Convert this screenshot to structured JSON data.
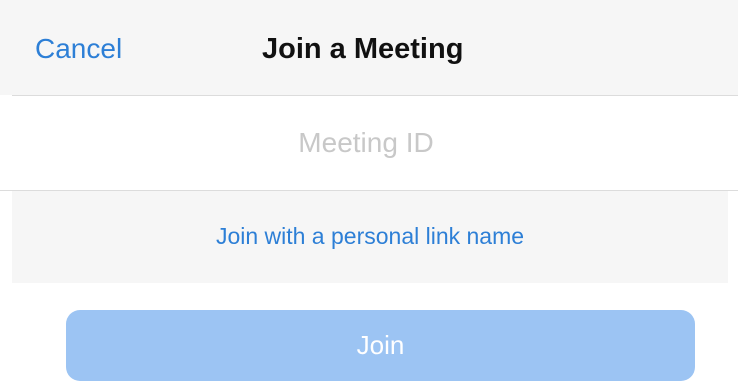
{
  "header": {
    "cancel_label": "Cancel",
    "title": "Join a Meeting"
  },
  "meeting_id": {
    "value": "",
    "placeholder": "Meeting ID"
  },
  "personal_link": {
    "label": "Join with a personal link name"
  },
  "join_button": {
    "label": "Join",
    "enabled": false
  },
  "colors": {
    "accent": "#2d7fd6",
    "join_button_disabled": "#9cc4f3",
    "header_background": "#f6f6f6",
    "placeholder_text": "#c8c8c8"
  }
}
